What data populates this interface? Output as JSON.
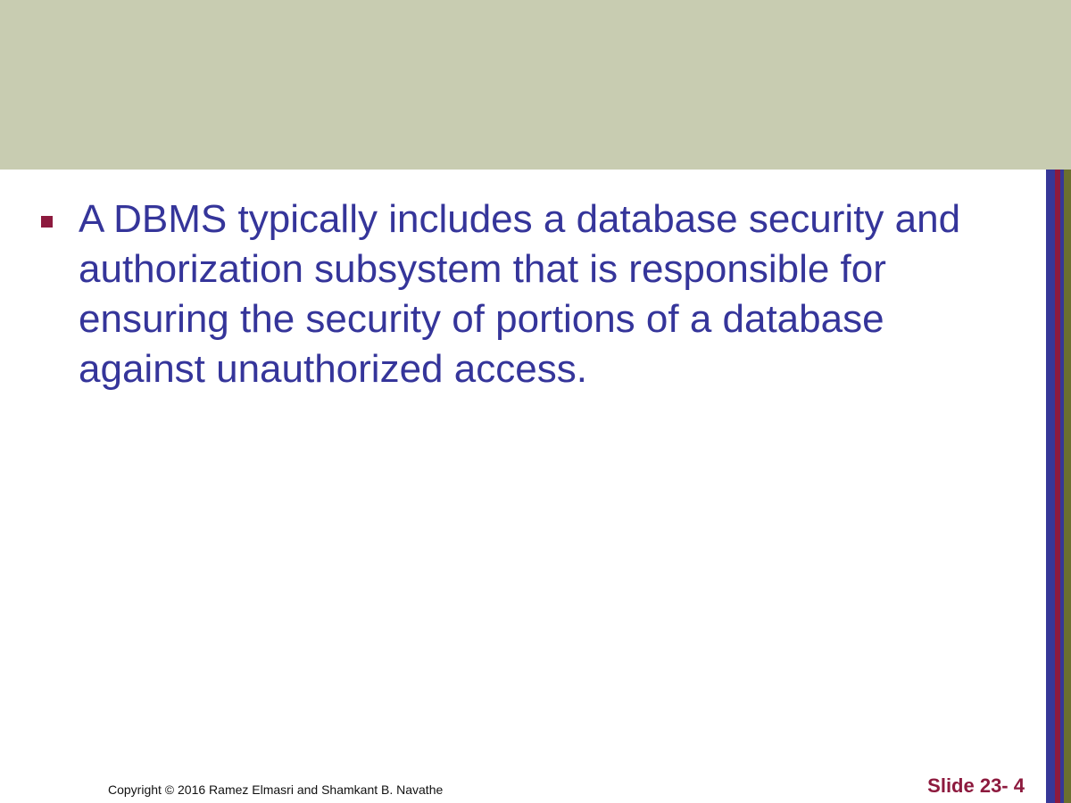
{
  "slide": {
    "bullets": [
      {
        "text": "A DBMS typically includes a database security and authorization subsystem that is responsible for ensuring the security of portions of a database against unauthorized access."
      }
    ],
    "footer": {
      "copyright": "Copyright © 2016 Ramez Elmasri and Shamkant B. Navathe",
      "slide_number": "Slide 23- 4"
    }
  },
  "colors": {
    "header_band": "#c8ccb1",
    "text_blue": "#35359a",
    "accent_maroon": "#8d1a3e",
    "stripe_olive": "#6b7030"
  }
}
